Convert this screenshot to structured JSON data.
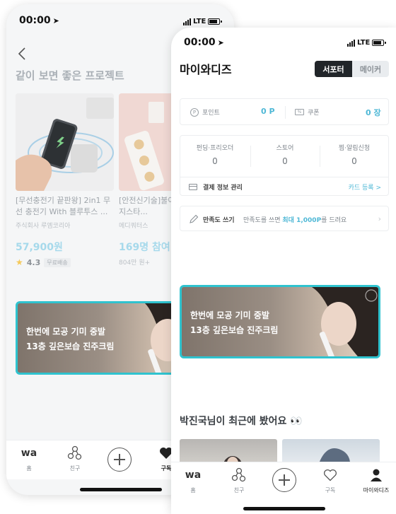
{
  "back_screen": {
    "status": {
      "time": "00:00",
      "carrier": "LTE"
    },
    "section_title": "같이 보면 좋은 프로젝트",
    "products": [
      {
        "title": "[무선충전기 끝판왕] 2in1 무선 충전기 With 블루투스 ...",
        "maker": "주식회사 루엠코리아",
        "price": "57,900원",
        "rating": "4.3",
        "badge": "무료배송"
      },
      {
        "title": "[안전신기술]불이 끝, 화재방지스타...",
        "maker": "메디쿼터스",
        "participants": "169명 참여",
        "raised": "804만 원+"
      }
    ],
    "ad": {
      "line1": "한번에 모공 기미 중발",
      "line2": "13층 깊은보습 진주크림"
    },
    "tabbar": [
      {
        "logo": "wa",
        "label": "홈"
      },
      {
        "label": "친구"
      },
      {
        "label": "구독"
      }
    ]
  },
  "front_screen": {
    "status": {
      "time": "00:00",
      "carrier": "LTE"
    },
    "title": "마이와디즈",
    "segment": {
      "supporter": "서포터",
      "maker": "메이커"
    },
    "points": {
      "point_label": "포인트",
      "point_value": "0 P",
      "coupon_label": "쿠폰",
      "coupon_value": "0 장"
    },
    "stats": [
      {
        "label": "펀딩·프리오더",
        "value": "0"
      },
      {
        "label": "스토어",
        "value": "0"
      },
      {
        "label": "찜·알림신청",
        "value": "0"
      }
    ],
    "payment": {
      "label": "결제 정보 관리",
      "action": "카드 등록 >"
    },
    "review": {
      "label": "만족도 쓰기",
      "desc_prefix": "만족도를 쓰면 ",
      "desc_highlight": "최대 1,000P",
      "desc_suffix": "를 드려요"
    },
    "ad": {
      "line1": "한번에 모공 기미 중발",
      "line2": "13층 깊은보습 진주크림"
    },
    "recent_title": "박진국님이 최근에 봤어요 👀",
    "tabbar": [
      {
        "logo": "wa",
        "label": "홈"
      },
      {
        "label": "친구"
      },
      {
        "label": "구독"
      },
      {
        "label": "마이와디즈"
      }
    ]
  },
  "colors": {
    "accent": "#4fb8d6",
    "ad_border": "#2fc3cf",
    "dark": "#212529"
  }
}
